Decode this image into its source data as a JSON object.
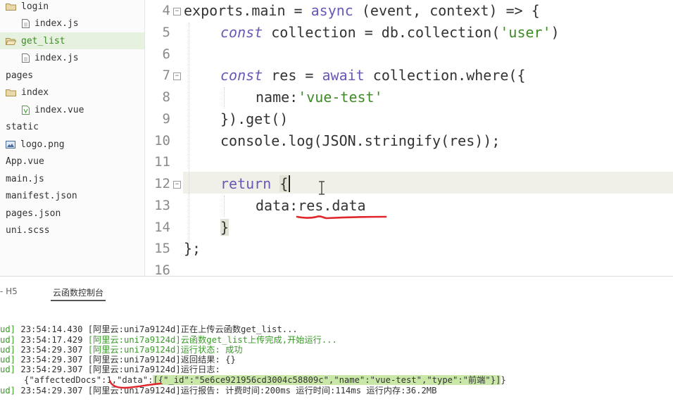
{
  "sidebar": {
    "items": [
      {
        "label": "login",
        "type": "folder"
      },
      {
        "label": "index.js",
        "type": "file-js"
      },
      {
        "label": "get_list",
        "type": "folder-open"
      },
      {
        "label": "index.js",
        "type": "file-js"
      },
      {
        "label": "pages",
        "type": "text"
      },
      {
        "label": "index",
        "type": "folder"
      },
      {
        "label": "index.vue",
        "type": "file-vue"
      },
      {
        "label": "static",
        "type": "text"
      },
      {
        "label": "logo.png",
        "type": "file-image"
      },
      {
        "label": "App.vue",
        "type": "text"
      },
      {
        "label": "main.js",
        "type": "text"
      },
      {
        "label": "manifest.json",
        "type": "text"
      },
      {
        "label": "pages.json",
        "type": "text"
      },
      {
        "label": "uni.scss",
        "type": "text"
      }
    ]
  },
  "editor": {
    "line_numbers": [
      "4",
      "5",
      "6",
      "7",
      "8",
      "9",
      "10",
      "11",
      "12",
      "13",
      "14",
      "15",
      "16"
    ],
    "lines": {
      "l4_exports": "exports",
      "l4_main": ".main = ",
      "l4_async": "async",
      "l4_rest": " (event, context) => {",
      "l5_const": "const",
      "l5_rest": " collection = db.collection(",
      "l5_str": "'user'",
      "l5_end": ")",
      "l7_const": "const",
      "l7_mid": " res = ",
      "l7_await": "await",
      "l7_rest": " collection.where({",
      "l8_key": "name:",
      "l8_str": "'vue-test'",
      "l9": "}).get()",
      "l10": "console.log(JSON.stringify(res));",
      "l12_return": "return",
      "l12_brace": "{",
      "l13_key": "data:",
      "l13_val": "res.data",
      "l14": "}",
      "l15": "};"
    }
  },
  "panel": {
    "tabs": [
      "- H5",
      "云函数控制台"
    ],
    "logs": [
      {
        "prefix": "ud]",
        "time": "23:54:14.430",
        "msg": "[阿里云:uni7a9124d]正在上传云函数get_list...",
        "color": "dark"
      },
      {
        "prefix": "ud]",
        "time": "23:54:17.429",
        "msg": "[阿里云:uni7a9124d]云函数get_list上传完成,开始运行...",
        "color": "green"
      },
      {
        "prefix": "ud]",
        "time": "23:54:29.307",
        "msg": "[阿里云:uni7a9124d]运行状态: 成功",
        "color": "green"
      },
      {
        "prefix": "ud]",
        "time": "23:54:29.307",
        "msg": "[阿里云:uni7a9124d]返回结果: {}",
        "color": "dark"
      },
      {
        "prefix": "ud]",
        "time": "23:54:29.307",
        "msg": "[阿里云:uni7a9124d]运行日志:",
        "color": "dark"
      }
    ],
    "json_line": {
      "part1": "{\"affectedDocs\":1,\"data\":",
      "part2": "[{\"_id\":\"5e6ce921956cd3004c58809c\",\"name\":\"vue-test\",\"type\":\"前端\"}]",
      "part3": "}"
    },
    "last_log": {
      "prefix": "ud]",
      "time": "23:54:29.307",
      "msg": "[阿里云:uni7a9124d]运行报告: 计费时间:200ms 运行时间:114ms 运行内存:36.2MB"
    }
  },
  "colors": {
    "accent_green": "#3a9a28",
    "keyword": "#6b57b5",
    "annotation_red": "#e0262a"
  }
}
